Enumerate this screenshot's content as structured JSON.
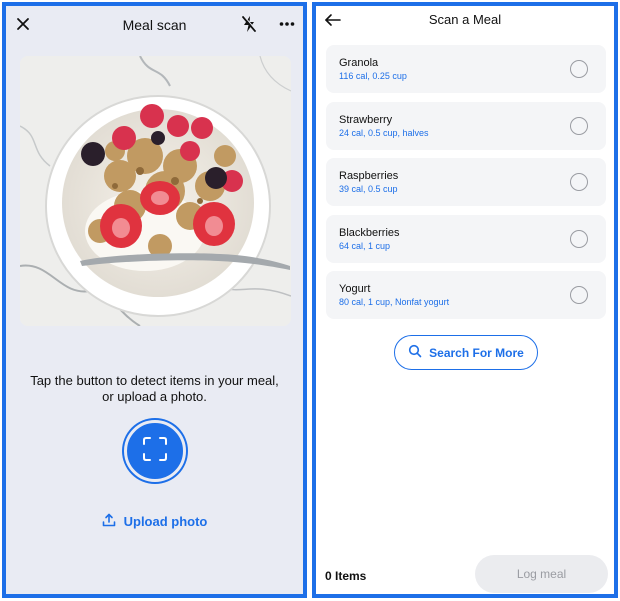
{
  "left": {
    "header": {
      "title": "Meal scan",
      "close_icon": "close-icon",
      "flash_icon": "flash-off-icon",
      "more_icon": "more-icon"
    },
    "photo": {
      "description_icon": "meal-photo"
    },
    "instruction": "Tap the button to detect items in your meal, or upload a photo.",
    "scan_button_icon": "scan-icon",
    "upload": {
      "icon": "upload-icon",
      "label": "Upload photo"
    }
  },
  "right": {
    "header": {
      "title": "Scan a Meal",
      "back_icon": "back-arrow-icon"
    },
    "foods": [
      {
        "name": "Granola",
        "detail": "116 cal, 0.25 cup"
      },
      {
        "name": "Strawberry",
        "detail": "24 cal, 0.5 cup, halves"
      },
      {
        "name": "Raspberries",
        "detail": "39 cal, 0.5 cup"
      },
      {
        "name": "Blackberries",
        "detail": "64 cal, 1 cup"
      },
      {
        "name": "Yogurt",
        "detail": "80 cal, 1 cup, Nonfat yogurt"
      }
    ],
    "search_more": {
      "icon": "search-icon",
      "label": "Search For More"
    },
    "footer": {
      "items_count": "0 Items",
      "log_label": "Log meal"
    }
  },
  "colors": {
    "accent": "#1d6fe8",
    "left_bg": "#e9ebf3",
    "card_bg": "#f4f5f7",
    "disabled_bg": "#ebecef",
    "disabled_text": "#9a9ca2"
  }
}
